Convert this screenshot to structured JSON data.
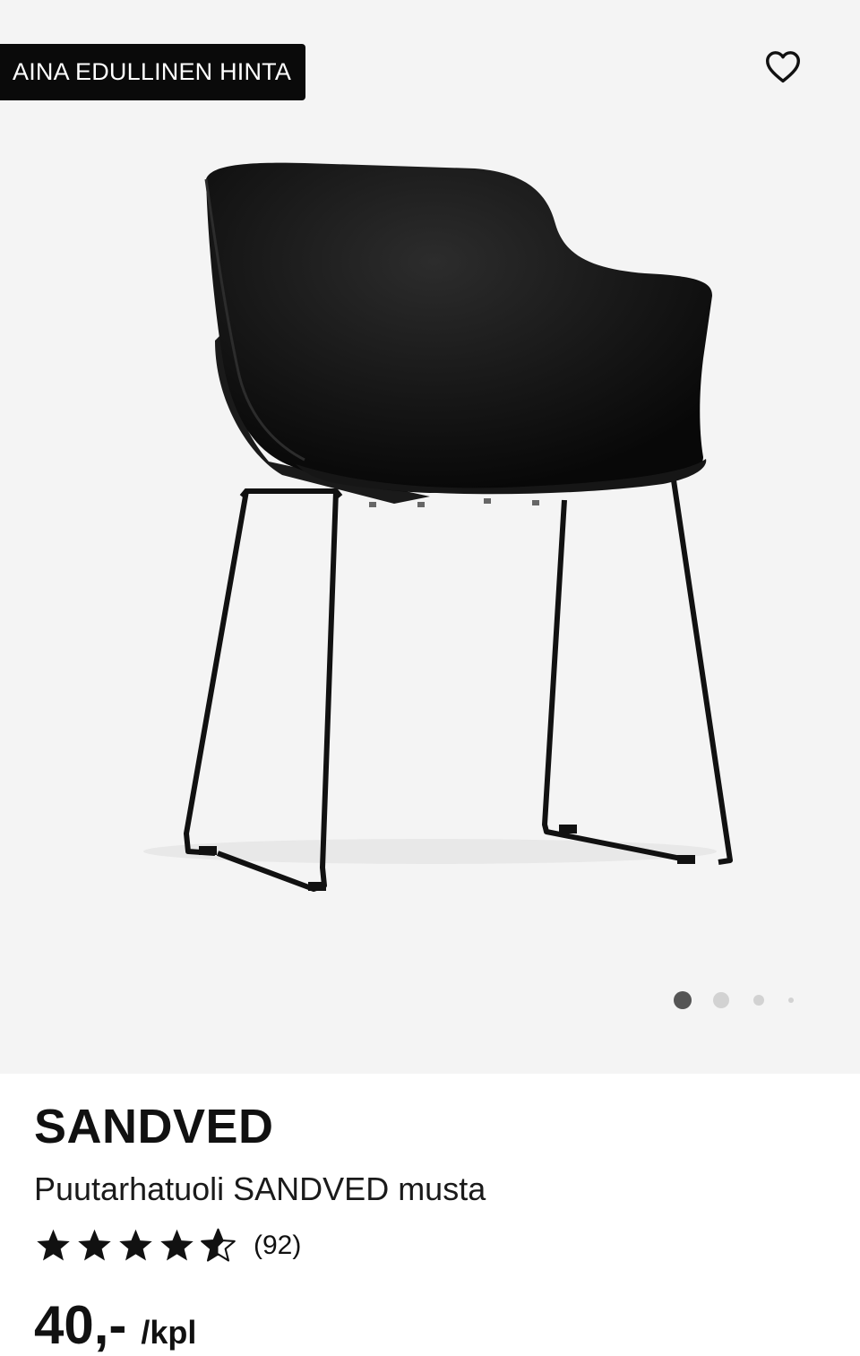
{
  "badge": {
    "label": "AINA EDULLINEN HINTA"
  },
  "favorite": {
    "icon": "heart-outline-icon"
  },
  "gallery": {
    "image_count": 4,
    "active_index": 0
  },
  "product": {
    "name": "SANDVED",
    "description": "Puutarhatuoli SANDVED musta",
    "rating": {
      "stars": 4.5,
      "max": 5,
      "count_label": "(92)"
    },
    "price": {
      "value": "40,-",
      "unit": "/kpl"
    }
  },
  "colors": {
    "badge_bg": "#0a0a0a",
    "hero_bg": "#f4f4f4",
    "active_dot": "#555555",
    "inactive_dot": "#d2d2d2"
  }
}
